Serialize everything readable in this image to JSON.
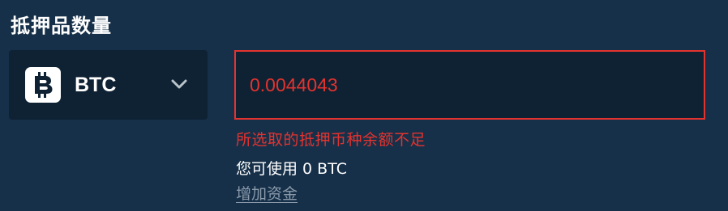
{
  "collateral": {
    "title": "抵押品数量",
    "currency": {
      "label": "BTC",
      "icon": "bitcoin-icon",
      "dropdown_icon": "chevron-down-icon"
    },
    "amount_value": "0.0044043",
    "error_message": "所选取的抵押币种余额不足",
    "available": {
      "text": "您可使用 0 BTC"
    },
    "add_funds_label": "增加资金"
  },
  "colors": {
    "background": "#163049",
    "field_background": "#0f2233",
    "error": "#e3332f",
    "text": "#ffffff",
    "muted_link": "#8a9aaa"
  }
}
